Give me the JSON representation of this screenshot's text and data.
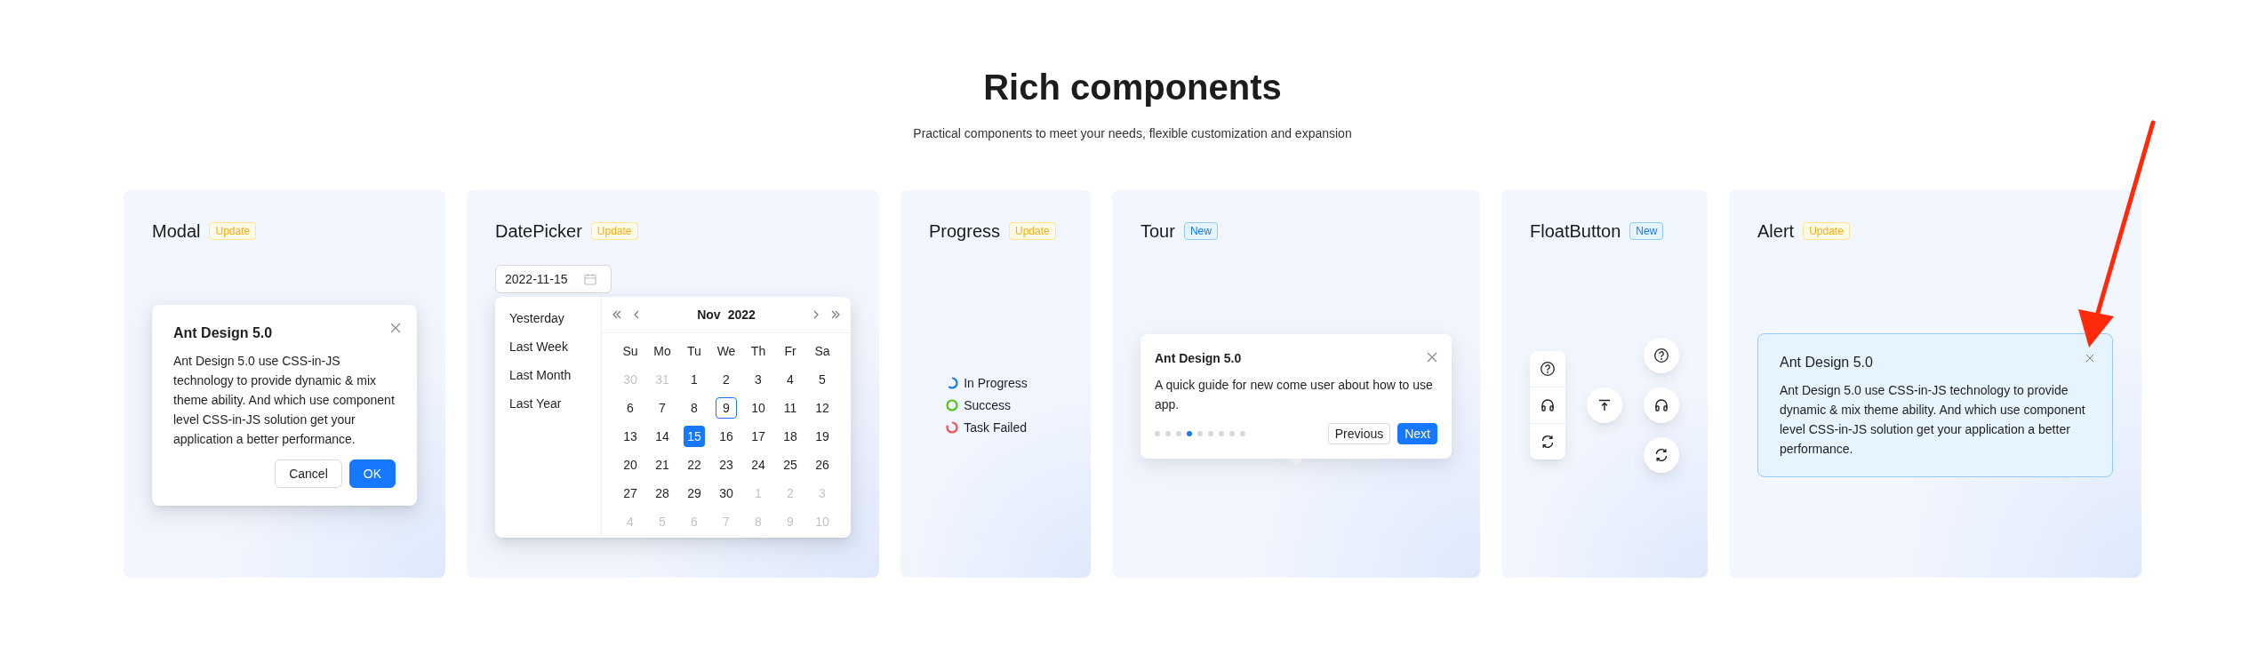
{
  "heading": "Rich components",
  "subheading": "Practical components to meet your needs, flexible customization and expansion",
  "cards": [
    {
      "kind": "modal",
      "title": "Modal",
      "badge": {
        "text": "Update",
        "kind": "update"
      },
      "modal": {
        "title": "Ant Design 5.0",
        "body": "Ant Design 5.0 use CSS-in-JS technology to provide dynamic & mix theme ability. And which use component level CSS-in-JS solution get your application a better performance.",
        "buttons": [
          {
            "label": "Cancel",
            "kind": "default"
          },
          {
            "label": "OK",
            "kind": "primary"
          }
        ]
      }
    },
    {
      "kind": "datepicker",
      "title": "DatePicker",
      "badge": {
        "text": "Update",
        "kind": "update"
      },
      "picker": {
        "value": "2022-11-15",
        "presets": [
          "Yesterday",
          "Last Week",
          "Last Month",
          "Last Year"
        ],
        "month": "Nov",
        "year": "2022",
        "weekdays": [
          "Su",
          "Mo",
          "Tu",
          "We",
          "Th",
          "Fr",
          "Sa"
        ],
        "days": [
          {
            "label": "30",
            "in_month": false,
            "today": false,
            "selected": false
          },
          {
            "label": "31",
            "in_month": false,
            "today": false,
            "selected": false
          },
          {
            "label": "1",
            "in_month": true,
            "today": false,
            "selected": false
          },
          {
            "label": "2",
            "in_month": true,
            "today": false,
            "selected": false
          },
          {
            "label": "3",
            "in_month": true,
            "today": false,
            "selected": false
          },
          {
            "label": "4",
            "in_month": true,
            "today": false,
            "selected": false
          },
          {
            "label": "5",
            "in_month": true,
            "today": false,
            "selected": false
          },
          {
            "label": "6",
            "in_month": true,
            "today": false,
            "selected": false
          },
          {
            "label": "7",
            "in_month": true,
            "today": false,
            "selected": false
          },
          {
            "label": "8",
            "in_month": true,
            "today": false,
            "selected": false
          },
          {
            "label": "9",
            "in_month": true,
            "today": true,
            "selected": false
          },
          {
            "label": "10",
            "in_month": true,
            "today": false,
            "selected": false
          },
          {
            "label": "11",
            "in_month": true,
            "today": false,
            "selected": false
          },
          {
            "label": "12",
            "in_month": true,
            "today": false,
            "selected": false
          },
          {
            "label": "13",
            "in_month": true,
            "today": false,
            "selected": false
          },
          {
            "label": "14",
            "in_month": true,
            "today": false,
            "selected": false
          },
          {
            "label": "15",
            "in_month": true,
            "today": false,
            "selected": true
          },
          {
            "label": "16",
            "in_month": true,
            "today": false,
            "selected": false
          },
          {
            "label": "17",
            "in_month": true,
            "today": false,
            "selected": false
          },
          {
            "label": "18",
            "in_month": true,
            "today": false,
            "selected": false
          },
          {
            "label": "19",
            "in_month": true,
            "today": false,
            "selected": false
          },
          {
            "label": "20",
            "in_month": true,
            "today": false,
            "selected": false
          },
          {
            "label": "21",
            "in_month": true,
            "today": false,
            "selected": false
          },
          {
            "label": "22",
            "in_month": true,
            "today": false,
            "selected": false
          },
          {
            "label": "23",
            "in_month": true,
            "today": false,
            "selected": false
          },
          {
            "label": "24",
            "in_month": true,
            "today": false,
            "selected": false
          },
          {
            "label": "25",
            "in_month": true,
            "today": false,
            "selected": false
          },
          {
            "label": "26",
            "in_month": true,
            "today": false,
            "selected": false
          },
          {
            "label": "27",
            "in_month": true,
            "today": false,
            "selected": false
          },
          {
            "label": "28",
            "in_month": true,
            "today": false,
            "selected": false
          },
          {
            "label": "29",
            "in_month": true,
            "today": false,
            "selected": false
          },
          {
            "label": "30",
            "in_month": true,
            "today": false,
            "selected": false
          },
          {
            "label": "1",
            "in_month": false,
            "today": false,
            "selected": false
          },
          {
            "label": "2",
            "in_month": false,
            "today": false,
            "selected": false
          },
          {
            "label": "3",
            "in_month": false,
            "today": false,
            "selected": false
          },
          {
            "label": "4",
            "in_month": false,
            "today": false,
            "selected": false
          },
          {
            "label": "5",
            "in_month": false,
            "today": false,
            "selected": false
          },
          {
            "label": "6",
            "in_month": false,
            "today": false,
            "selected": false
          },
          {
            "label": "7",
            "in_month": false,
            "today": false,
            "selected": false
          },
          {
            "label": "8",
            "in_month": false,
            "today": false,
            "selected": false
          },
          {
            "label": "9",
            "in_month": false,
            "today": false,
            "selected": false
          },
          {
            "label": "10",
            "in_month": false,
            "today": false,
            "selected": false
          }
        ]
      }
    },
    {
      "kind": "progress",
      "title": "Progress",
      "badge": {
        "text": "Update",
        "kind": "update"
      },
      "items": [
        {
          "label": "In Progress",
          "kind": "active",
          "color": "#1677ff"
        },
        {
          "label": "Success",
          "kind": "success",
          "color": "#52c41a"
        },
        {
          "label": "Task Failed",
          "kind": "exception",
          "color": "#ff4d4f"
        }
      ]
    },
    {
      "kind": "tour",
      "title": "Tour",
      "badge": {
        "text": "New",
        "kind": "new"
      },
      "tour": {
        "title": "Ant Design 5.0",
        "body": "A quick guide for new come user about how to use app.",
        "steps": [
          {
            "selected": false
          },
          {
            "selected": false
          },
          {
            "selected": false
          },
          {
            "selected": true
          },
          {
            "selected": false
          },
          {
            "selected": false
          },
          {
            "selected": false
          },
          {
            "selected": false
          },
          {
            "selected": false
          }
        ],
        "buttons": [
          {
            "label": "Previous",
            "kind": "default"
          },
          {
            "label": "Next",
            "kind": "primary"
          }
        ]
      }
    },
    {
      "kind": "floatbutton",
      "title": "FloatButton",
      "badge": {
        "text": "New",
        "kind": "new"
      }
    },
    {
      "kind": "alert",
      "title": "Alert",
      "badge": {
        "text": "Update",
        "kind": "update"
      },
      "alert": {
        "title": "Ant Design 5.0",
        "body": "Ant Design 5.0 use CSS-in-JS technology to provide dynamic & mix theme ability. And which use component level CSS-in-JS solution get your application a better performance.",
        "closable": true
      }
    }
  ]
}
